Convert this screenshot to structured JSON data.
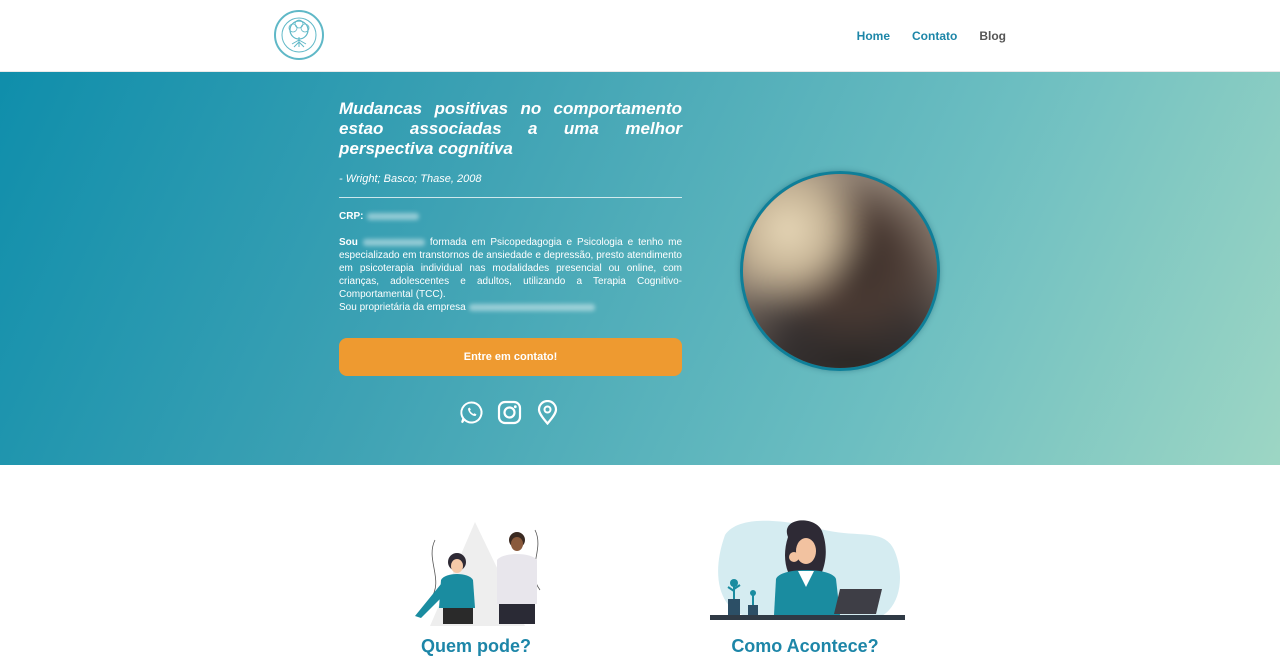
{
  "nav": {
    "items": [
      {
        "label": "Home"
      },
      {
        "label": "Contato"
      },
      {
        "label": "Blog"
      }
    ]
  },
  "hero": {
    "quote": "Mudancas positivas no comportamento estao associadas a uma melhor perspectiva cognitiva",
    "citation": "- Wright; Basco; Thase, 2008",
    "crp_label": "CRP:",
    "bio_sou": "Sou",
    "bio_main": "formada em Psicopedagogia e Psicologia e tenho me especializado em transtornos de ansiedade e depressão, presto atendimento em psicoterapia individual nas modalidades presencial ou online, com crianças, adolescentes e adultos, utilizando a Terapia Cognitivo-Comportamental (TCC).",
    "bio_owner": "Sou proprietária da empresa",
    "cta_label": "Entre em contato!",
    "socials": [
      "whatsapp-icon",
      "instagram-icon",
      "map-pin-icon"
    ]
  },
  "features": {
    "left_title": "Quem pode?",
    "right_title": "Como Acontece?"
  },
  "colors": {
    "brand": "#1d86a8",
    "cta": "#ee9a30",
    "gradient_start": "#0f8eab",
    "gradient_end": "#9dd6c4"
  }
}
